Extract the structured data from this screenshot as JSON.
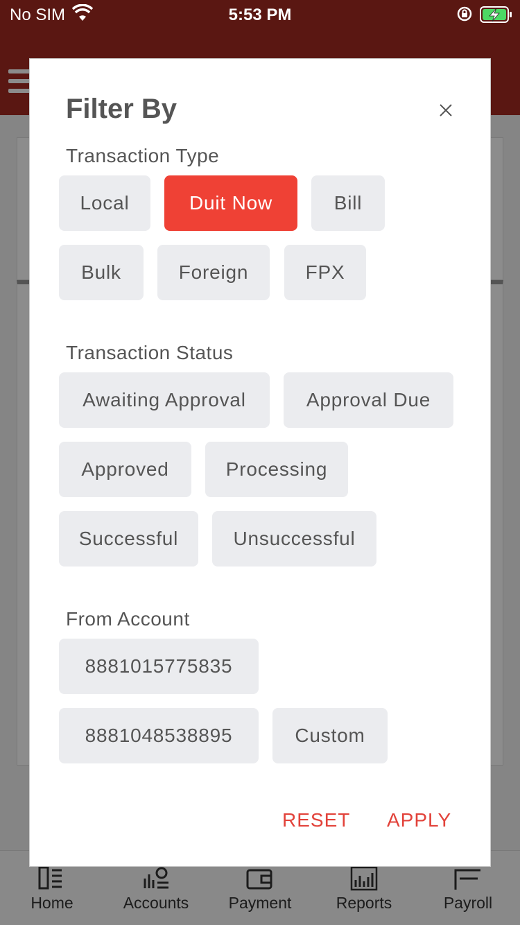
{
  "status_bar": {
    "carrier": "No SIM",
    "time": "5:53 PM"
  },
  "filter": {
    "title": "Filter By",
    "transaction_type": {
      "label": "Transaction Type",
      "options": [
        "Local",
        "Duit Now",
        "Bill",
        "Bulk",
        "Foreign",
        "FPX"
      ],
      "selected": "Duit Now"
    },
    "transaction_status": {
      "label": "Transaction Status",
      "options": [
        "Awaiting Approval",
        "Approval Due",
        "Approved",
        "Processing",
        "Successful",
        "Unsuccessful"
      ]
    },
    "from_account": {
      "label": "From Account",
      "options": [
        "8881015775835",
        "8881048538895",
        "Custom"
      ]
    },
    "reset_label": "RESET",
    "apply_label": "APPLY"
  },
  "tabbar": {
    "items": [
      {
        "label": "Home",
        "icon": "home-icon"
      },
      {
        "label": "Accounts",
        "icon": "accounts-icon"
      },
      {
        "label": "Payment",
        "icon": "wallet-icon"
      },
      {
        "label": "Reports",
        "icon": "reports-icon"
      },
      {
        "label": "Payroll",
        "icon": "payroll-icon"
      }
    ]
  },
  "colors": {
    "brand": "#a52a21",
    "accent": "#ef4135",
    "chip": "#ebecef",
    "action": "#e2423a"
  }
}
